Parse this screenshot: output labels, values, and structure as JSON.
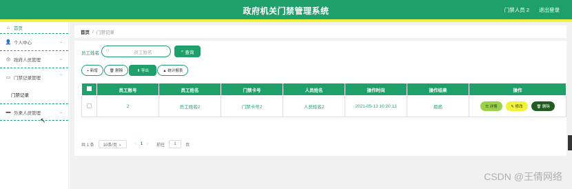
{
  "header": {
    "title": "政府机关门禁管理系统",
    "user": "门禁人员 2",
    "logout": "退出登录"
  },
  "sidebar": {
    "items": [
      {
        "label": "首页",
        "icon": "home-icon",
        "glyph": "⌂"
      },
      {
        "label": "个人中心",
        "icon": "user-icon",
        "glyph": "👤"
      },
      {
        "label": "政府人员管理",
        "icon": "circle-icon",
        "glyph": "◎"
      },
      {
        "label": "门禁记录管理",
        "icon": "doc-icon",
        "glyph": "▭"
      },
      {
        "label": "外来人员管理",
        "icon": "card-icon",
        "glyph": "▬"
      }
    ],
    "sub": "门禁记录"
  },
  "breadcrumb": {
    "home": "首页",
    "sep": "/",
    "current": "门禁记录"
  },
  "search": {
    "label": "员工姓名",
    "placeholder": "员工姓名",
    "button": "查询"
  },
  "buttons": {
    "add": "+ 新增",
    "delete": "🗑 删除",
    "export": "⬇ 导出",
    "stats": "▲ 统计报表"
  },
  "table": {
    "headers": [
      "员工账号",
      "员工姓名",
      "门禁卡号",
      "人员姓名",
      "操作时间",
      "操作结果",
      "操作"
    ],
    "row": [
      "2",
      "员工姓名2",
      "门禁卡号2",
      "人员姓名2",
      "2021-05-13 10:20:13",
      "拒绝"
    ],
    "actions": {
      "detail": "☰ 详情",
      "edit": "✎ 修改",
      "delete": "🗑 删除"
    }
  },
  "pager": {
    "total": "共 1 条",
    "size": "10条/页",
    "prev": "‹",
    "page": "1",
    "next": "›",
    "goto": "前往",
    "input": "1",
    "unit": "页"
  },
  "watermark": "CSDN @王倩网络"
}
